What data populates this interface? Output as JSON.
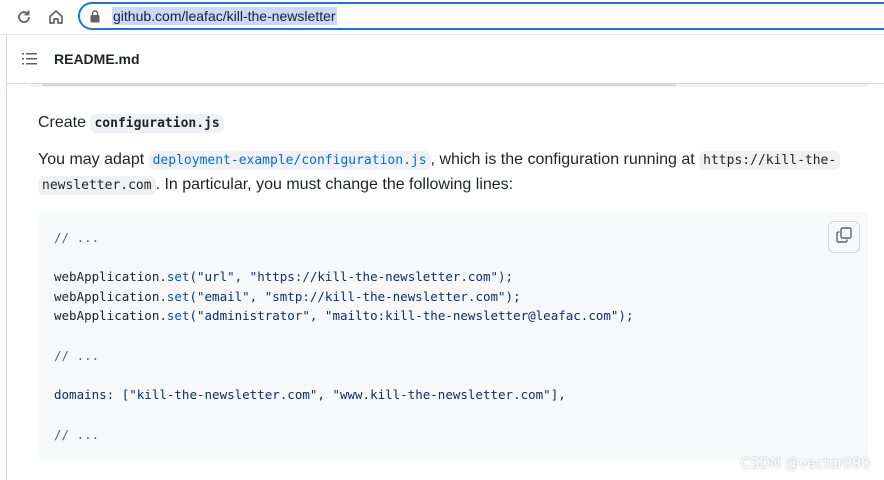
{
  "browser": {
    "url": "github.com/leafac/kill-the-newsletter",
    "back_icon": "reload-icon",
    "home_icon": "home-icon",
    "lock_icon": "lock-icon"
  },
  "readme": {
    "title": "README.md"
  },
  "content": {
    "create_prefix": "Create",
    "create_file": "configuration.js",
    "p2_part1": "You may adapt",
    "p2_link": "deployment-example/configuration.js",
    "p2_part2": ", which is the configuration running at",
    "p2_url_line1": "https://kill-the-",
    "p2_url_line2": "newsletter.com",
    "p2_part3": ". In particular, you must change the following lines:"
  },
  "code": {
    "line1": "// ...",
    "line2_obj": "webApplication.",
    "line2_fn": "set",
    "line2_args": "(\"url\", \"https://kill-the-newsletter.com\");",
    "line3_obj": "webApplication.",
    "line3_fn": "set",
    "line3_args": "(\"email\", \"smtp://kill-the-newsletter.com\");",
    "line4_obj": "webApplication.",
    "line4_fn": "set",
    "line4_args": "(\"administrator\", \"mailto:kill-the-newsletter@leafac.com\");",
    "line5": "// ...",
    "line6": "domains: [\"kill-the-newsletter.com\", \"www.kill-the-newsletter.com\"],",
    "line7": "// ..."
  },
  "watermark": "CSDN @vector090",
  "colors": {
    "accent": "#1a73e8",
    "link": "#0969da",
    "code_bg": "#f6f8fa"
  }
}
